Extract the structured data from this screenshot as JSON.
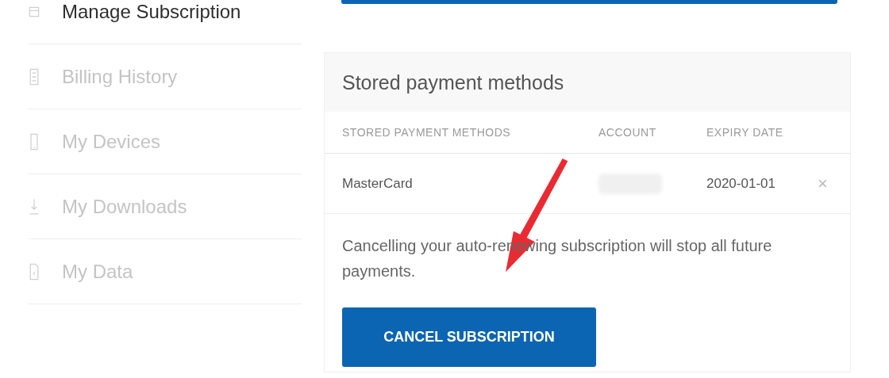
{
  "sidebar": {
    "items": [
      {
        "label": "Manage Subscription",
        "selected": true
      },
      {
        "label": "Billing History",
        "selected": false
      },
      {
        "label": "My Devices",
        "selected": false
      },
      {
        "label": "My Downloads",
        "selected": false
      },
      {
        "label": "My Data",
        "selected": false
      }
    ]
  },
  "payment_card": {
    "title": "Stored payment methods",
    "columns": [
      "STORED PAYMENT METHODS",
      "ACCOUNT",
      "EXPIRY DATE"
    ],
    "rows": [
      {
        "method": "MasterCard",
        "account_redacted": true,
        "expiry": "2020-01-01",
        "remove": "×"
      }
    ],
    "notice": "Cancelling your auto-renewing subscription will stop all future payments.",
    "cancel_button": "CANCEL SUBSCRIPTION"
  }
}
